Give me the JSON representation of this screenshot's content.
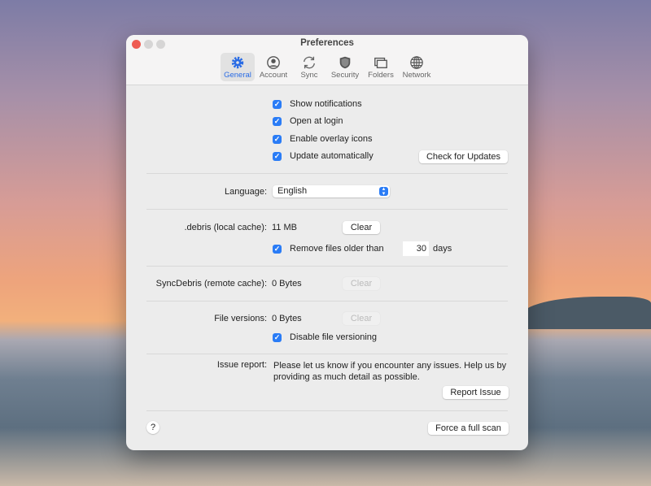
{
  "window": {
    "title": "Preferences"
  },
  "tabs": [
    {
      "label": "General",
      "icon": "gear-icon",
      "active": true
    },
    {
      "label": "Account",
      "icon": "person-circle-icon"
    },
    {
      "label": "Sync",
      "icon": "sync-arrows-icon"
    },
    {
      "label": "Security",
      "icon": "shield-icon"
    },
    {
      "label": "Folders",
      "icon": "folders-icon"
    },
    {
      "label": "Network",
      "icon": "globe-icon"
    }
  ],
  "general": {
    "options": [
      {
        "label": "Show notifications",
        "checked": true
      },
      {
        "label": "Open at login",
        "checked": true
      },
      {
        "label": "Enable overlay icons",
        "checked": true
      },
      {
        "label": "Update automatically",
        "checked": true
      }
    ],
    "check_updates": "Check for Updates",
    "language_label": "Language:",
    "language_value": "English",
    "local_cache_label": ".debris (local cache):",
    "local_cache_value": "11 MB",
    "clear": "Clear",
    "remove_older_label": "Remove files older than",
    "remove_older_checked": true,
    "remove_days": "30",
    "days": "days",
    "remote_cache_label": "SyncDebris (remote cache):",
    "remote_cache_value": "0 Bytes",
    "versions_label": "File versions:",
    "versions_value": "0 Bytes",
    "disable_versioning": "Disable file versioning",
    "disable_versioning_checked": true,
    "issue_label": "Issue report:",
    "issue_text": "Please let us know if you encounter any issues. Help us by providing as much detail as possible.",
    "report_issue": "Report Issue",
    "help": "?",
    "full_scan": "Force a full scan"
  },
  "colors": {
    "accent": "#2a7cf6",
    "close": "#ee5b52"
  }
}
